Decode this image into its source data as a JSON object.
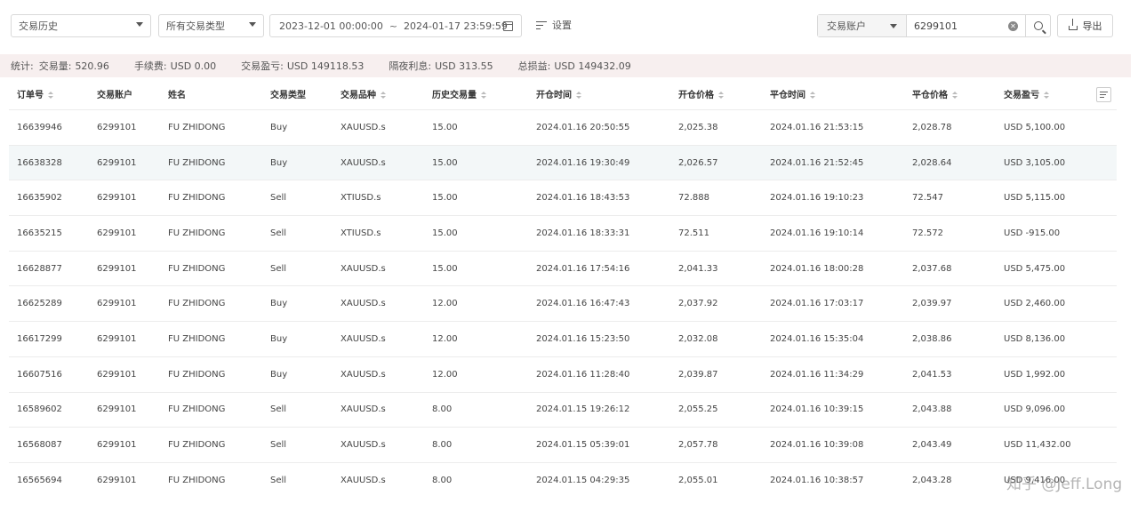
{
  "toolbar": {
    "history_select": "交易历史",
    "type_select": "所有交易类型",
    "date_start": "2023-12-01 00:00:00",
    "date_sep": "~",
    "date_end": "2024-01-17 23:59:59",
    "settings_label": "设置",
    "account_type": "交易账户",
    "account_value": "6299101",
    "export_label": "导出"
  },
  "stats": {
    "prefix": "统计:",
    "volume_label": "交易量:",
    "volume": "520.96",
    "fee_label": "手续费:",
    "fee": "USD 0.00",
    "pnl_label": "交易盈亏:",
    "pnl": "USD 149118.53",
    "swap_label": "隔夜利息:",
    "swap": "USD 313.55",
    "total_label": "总损益:",
    "total": "USD 149432.09"
  },
  "table": {
    "headers": [
      "订单号",
      "交易账户",
      "姓名",
      "交易类型",
      "交易品种",
      "历史交易量",
      "开仓时间",
      "开仓价格",
      "平仓时间",
      "平仓价格",
      "交易盈亏"
    ],
    "rows": [
      [
        "16639946",
        "6299101",
        "FU ZHIDONG",
        "Buy",
        "XAUUSD.s",
        "15.00",
        "2024.01.16 20:50:55",
        "2,025.38",
        "2024.01.16 21:53:15",
        "2,028.78",
        "USD 5,100.00"
      ],
      [
        "16638328",
        "6299101",
        "FU ZHIDONG",
        "Buy",
        "XAUUSD.s",
        "15.00",
        "2024.01.16 19:30:49",
        "2,026.57",
        "2024.01.16 21:52:45",
        "2,028.64",
        "USD 3,105.00"
      ],
      [
        "16635902",
        "6299101",
        "FU ZHIDONG",
        "Sell",
        "XTIUSD.s",
        "15.00",
        "2024.01.16 18:43:53",
        "72.888",
        "2024.01.16 19:10:23",
        "72.547",
        "USD 5,115.00"
      ],
      [
        "16635215",
        "6299101",
        "FU ZHIDONG",
        "Sell",
        "XTIUSD.s",
        "15.00",
        "2024.01.16 18:33:31",
        "72.511",
        "2024.01.16 19:10:14",
        "72.572",
        "USD -915.00"
      ],
      [
        "16628877",
        "6299101",
        "FU ZHIDONG",
        "Sell",
        "XAUUSD.s",
        "15.00",
        "2024.01.16 17:54:16",
        "2,041.33",
        "2024.01.16 18:00:28",
        "2,037.68",
        "USD 5,475.00"
      ],
      [
        "16625289",
        "6299101",
        "FU ZHIDONG",
        "Buy",
        "XAUUSD.s",
        "12.00",
        "2024.01.16 16:47:43",
        "2,037.92",
        "2024.01.16 17:03:17",
        "2,039.97",
        "USD 2,460.00"
      ],
      [
        "16617299",
        "6299101",
        "FU ZHIDONG",
        "Buy",
        "XAUUSD.s",
        "12.00",
        "2024.01.16 15:23:50",
        "2,032.08",
        "2024.01.16 15:35:04",
        "2,038.86",
        "USD 8,136.00"
      ],
      [
        "16607516",
        "6299101",
        "FU ZHIDONG",
        "Buy",
        "XAUUSD.s",
        "12.00",
        "2024.01.16 11:28:40",
        "2,039.87",
        "2024.01.16 11:34:29",
        "2,041.53",
        "USD 1,992.00"
      ],
      [
        "16589602",
        "6299101",
        "FU ZHIDONG",
        "Sell",
        "XAUUSD.s",
        "8.00",
        "2024.01.15 19:26:12",
        "2,055.25",
        "2024.01.16 10:39:15",
        "2,043.88",
        "USD 9,096.00"
      ],
      [
        "16568087",
        "6299101",
        "FU ZHIDONG",
        "Sell",
        "XAUUSD.s",
        "8.00",
        "2024.01.15 05:39:01",
        "2,057.78",
        "2024.01.16 10:39:08",
        "2,043.49",
        "USD 11,432.00"
      ],
      [
        "16565694",
        "6299101",
        "FU ZHIDONG",
        "Sell",
        "XAUUSD.s",
        "8.00",
        "2024.01.15 04:29:35",
        "2,055.01",
        "2024.01.16 10:38:57",
        "2,043.28",
        "USD 9,416.00"
      ]
    ],
    "highlight_row": 1
  },
  "watermark": "知乎 @Jeff.Long"
}
